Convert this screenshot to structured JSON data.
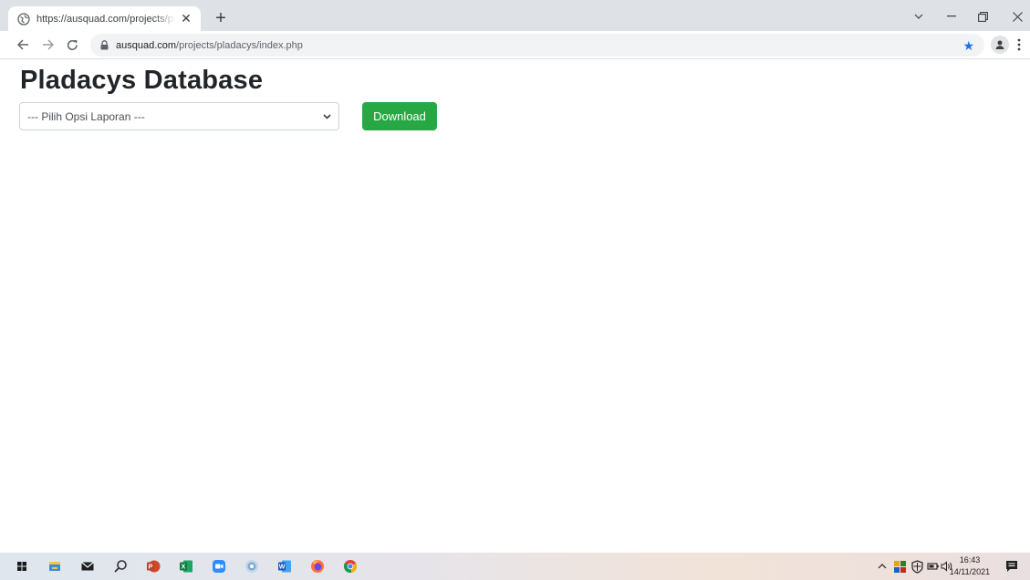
{
  "browser": {
    "tab_title": "https://ausquad.com/projects/pla",
    "url_host": "ausquad.com",
    "url_path": "/projects/pladacys/index.php"
  },
  "page": {
    "title": "Pladacys Database",
    "select_value": "--- Pilih Opsi Laporan ---",
    "download_label": "Download"
  },
  "colors": {
    "download_button": "#28a745",
    "bookmark_star": "#1a73e8"
  },
  "taskbar": {
    "apps": [
      "windows-start",
      "file-explorer",
      "mail",
      "search",
      "powerpoint",
      "excel",
      "zoom",
      "chrome-profile",
      "word",
      "firefox",
      "chrome"
    ],
    "clock_time": "16:43",
    "clock_date": "14/11/2021"
  }
}
